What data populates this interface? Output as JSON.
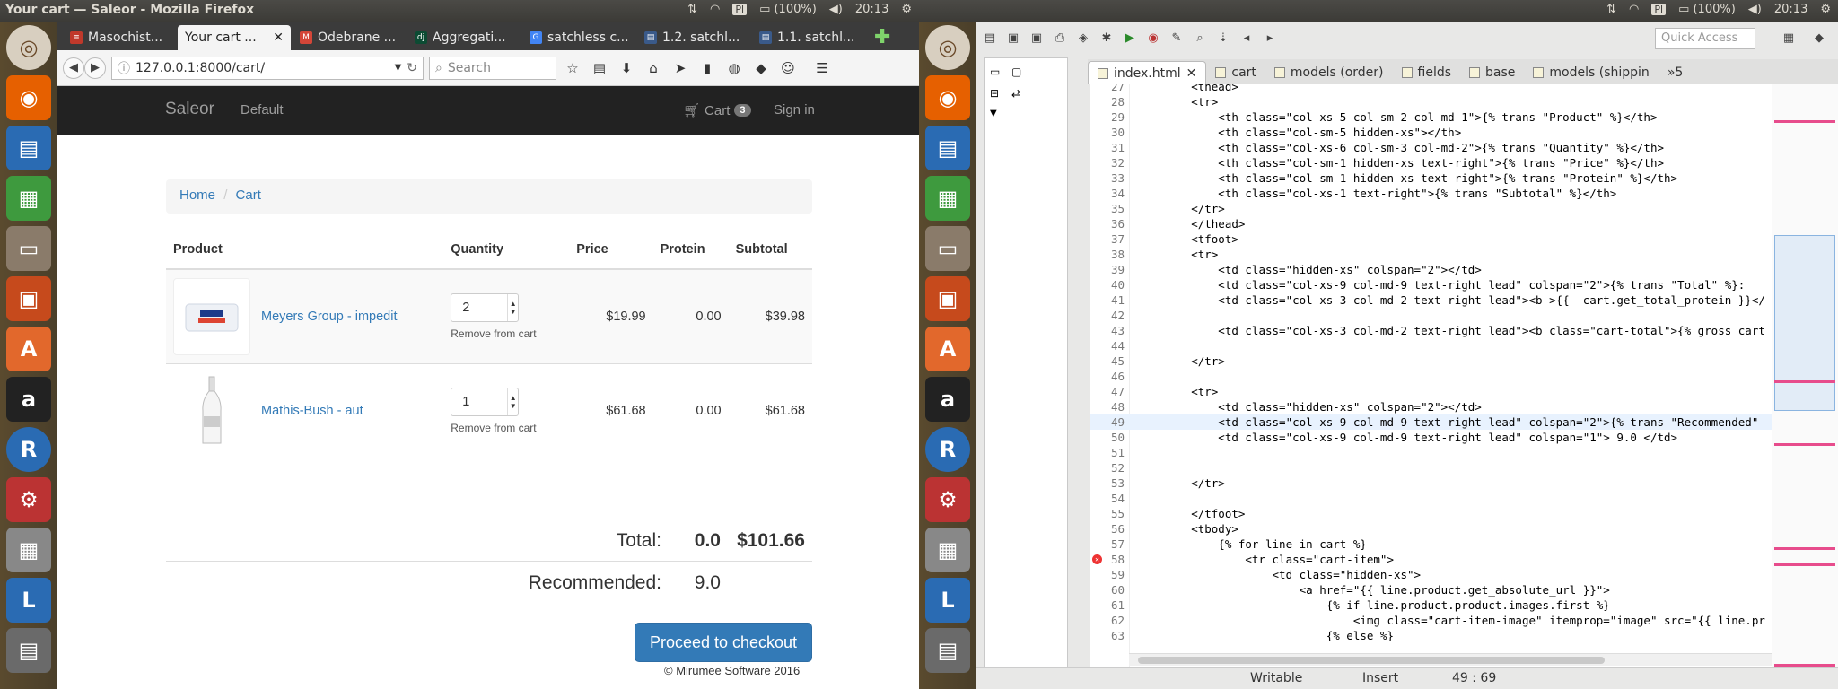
{
  "left": {
    "window_title": "Your cart — Saleor - Mozilla Firefox",
    "tray": {
      "keyboard": "Pl",
      "battery": "(100%)",
      "time": "20:13"
    },
    "tabs": [
      {
        "label": "Masochist...",
        "color": "#c0392b",
        "glyph": "≡"
      },
      {
        "label": "Your cart ...",
        "color": "#555",
        "glyph": ""
      },
      {
        "label": "Odebrane ...",
        "color": "#d44638",
        "glyph": "M"
      },
      {
        "label": "Aggregati...",
        "color": "#0c4b33",
        "glyph": "dj"
      },
      {
        "label": "satchless c...",
        "color": "#4285f4",
        "glyph": "G"
      },
      {
        "label": "1.2. satchl...",
        "color": "#3a5a8a",
        "glyph": "▤"
      },
      {
        "label": "1.1. satchl...",
        "color": "#3a5a8a",
        "glyph": "▤"
      }
    ],
    "url": "127.0.0.1:8000/cart/",
    "search_placeholder": "Search",
    "site": {
      "brand": "Saleor",
      "nav_default": "Default",
      "nav_cart": "Cart",
      "cart_count": "3",
      "nav_signin": "Sign in",
      "breadcrumb": {
        "home": "Home",
        "sep": "/",
        "current": "Cart"
      },
      "table": {
        "headers": {
          "product": "Product",
          "quantity": "Quantity",
          "price": "Price",
          "protein": "Protein",
          "subtotal": "Subtotal"
        },
        "rows": [
          {
            "name": "Meyers Group - impedit",
            "qty": "2",
            "remove": "Remove from cart",
            "price": "$19.99",
            "protein": "0.00",
            "subtotal": "$39.98"
          },
          {
            "name": "Mathis-Bush - aut",
            "qty": "1",
            "remove": "Remove from cart",
            "price": "$61.68",
            "protein": "0.00",
            "subtotal": "$61.68"
          }
        ]
      },
      "total_label": "Total:",
      "total_protein": "0.0",
      "total_amount": "$101.66",
      "recommended_label": "Recommended:",
      "recommended_value": "9.0",
      "checkout": "Proceed to checkout",
      "footer": "© Mirumee Software 2016"
    }
  },
  "right": {
    "tray": {
      "keyboard": "Pl",
      "battery": "(100%)",
      "time": "20:13"
    },
    "quick_access": "Quick Access",
    "editor_tabs": [
      "index.html",
      "cart",
      "models (order)",
      "fields",
      "base",
      "models (shippin",
      "»5"
    ],
    "code_lines": [
      {
        "n": "27",
        "t": "        <thead>"
      },
      {
        "n": "28",
        "t": "        <tr>"
      },
      {
        "n": "29",
        "t": "            <th class=\"col-xs-5 col-sm-2 col-md-1\">{% trans \"Product\" %}</th>"
      },
      {
        "n": "30",
        "t": "            <th class=\"col-sm-5 hidden-xs\"></th>"
      },
      {
        "n": "31",
        "t": "            <th class=\"col-xs-6 col-sm-3 col-md-2\">{% trans \"Quantity\" %}</th>"
      },
      {
        "n": "32",
        "t": "            <th class=\"col-sm-1 hidden-xs text-right\">{% trans \"Price\" %}</th>"
      },
      {
        "n": "33",
        "t": "            <th class=\"col-sm-1 hidden-xs text-right\">{% trans \"Protein\" %}</th>"
      },
      {
        "n": "34",
        "t": "            <th class=\"col-xs-1 text-right\">{% trans \"Subtotal\" %}</th>"
      },
      {
        "n": "35",
        "t": "        </tr>"
      },
      {
        "n": "36",
        "t": "        </thead>"
      },
      {
        "n": "37",
        "t": "        <tfoot>"
      },
      {
        "n": "38",
        "t": "        <tr>"
      },
      {
        "n": "39",
        "t": "            <td class=\"hidden-xs\" colspan=\"2\"></td>"
      },
      {
        "n": "40",
        "t": "            <td class=\"col-xs-9 col-md-9 text-right lead\" colspan=\"2\">{% trans \"Total\" %}:"
      },
      {
        "n": "41",
        "t": "            <td class=\"col-xs-3 col-md-2 text-right lead\"><b >{{  cart.get_total_protein }}</"
      },
      {
        "n": "42",
        "t": ""
      },
      {
        "n": "43",
        "t": "            <td class=\"col-xs-3 col-md-2 text-right lead\"><b class=\"cart-total\">{% gross cart"
      },
      {
        "n": "44",
        "t": ""
      },
      {
        "n": "45",
        "t": "        </tr>"
      },
      {
        "n": "46",
        "t": ""
      },
      {
        "n": "47",
        "t": "        <tr>"
      },
      {
        "n": "48",
        "t": "            <td class=\"hidden-xs\" colspan=\"2\"></td>"
      },
      {
        "n": "49",
        "t": "            <td class=\"col-xs-9 col-md-9 text-right lead\" colspan=\"2\">{% trans \"Recommended\""
      },
      {
        "n": "50",
        "t": "            <td class=\"col-xs-9 col-md-9 text-right lead\" colspan=\"1\"> 9.0 </td>"
      },
      {
        "n": "51",
        "t": ""
      },
      {
        "n": "52",
        "t": ""
      },
      {
        "n": "53",
        "t": "        </tr>"
      },
      {
        "n": "54",
        "t": ""
      },
      {
        "n": "55",
        "t": "        </tfoot>"
      },
      {
        "n": "56",
        "t": "        <tbody>"
      },
      {
        "n": "57",
        "t": "            {% for line in cart %}"
      },
      {
        "n": "58",
        "t": "                <tr class=\"cart-item\">"
      },
      {
        "n": "59",
        "t": "                    <td class=\"hidden-xs\">"
      },
      {
        "n": "60",
        "t": "                        <a href=\"{{ line.product.get_absolute_url }}\">"
      },
      {
        "n": "61",
        "t": "                            {% if line.product.product.images.first %}"
      },
      {
        "n": "62",
        "t": "                                <img class=\"cart-item-image\" itemprop=\"image\" src=\"{{ line.pr"
      },
      {
        "n": "63",
        "t": "                            {% else %}"
      }
    ],
    "status": {
      "mode": "Writable",
      "insert": "Insert",
      "position": "49 : 69"
    }
  }
}
